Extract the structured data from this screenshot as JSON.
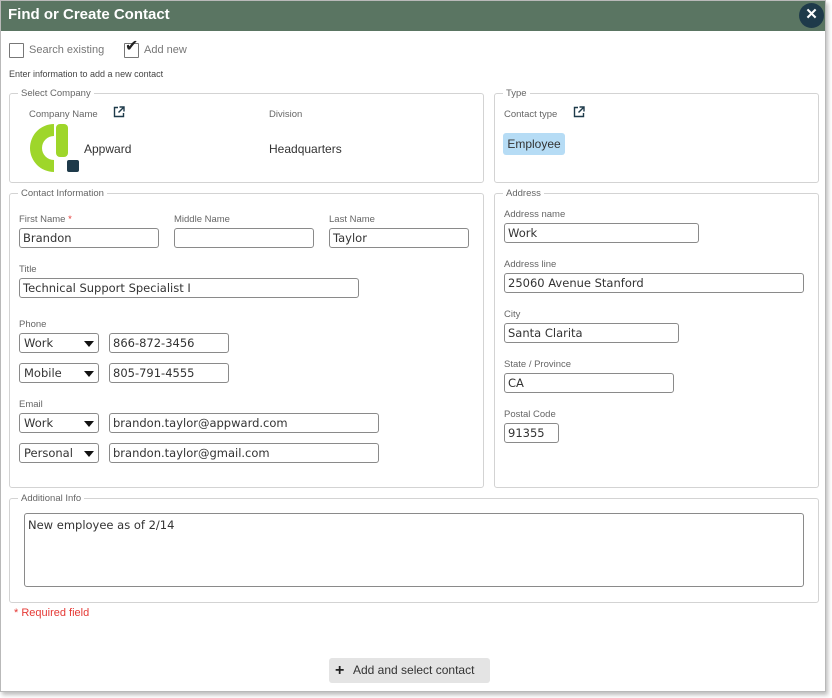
{
  "dialog": {
    "title": "Find or Create Contact",
    "close_icon": "close-icon"
  },
  "mode": {
    "search_existing": {
      "label": "Search existing",
      "checked": false
    },
    "add_new": {
      "label": "Add new",
      "checked": true
    },
    "instructions": "Enter information to add a new contact"
  },
  "select_company": {
    "legend": "Select Company",
    "company_name_label": "Company Name",
    "company_name": "Appward",
    "division_label": "Division",
    "division": "Headquarters",
    "logo_colors": {
      "ring": "#9ed62a",
      "square": "#1e3a4a"
    }
  },
  "type": {
    "legend": "Type",
    "contact_type_label": "Contact type",
    "contact_type": "Employee",
    "badge_color": "#b6dcf5"
  },
  "contact_info": {
    "legend": "Contact Information",
    "first_name_label": "First Name",
    "required_marker": "*",
    "first_name": "Brandon",
    "middle_name_label": "Middle Name",
    "middle_name": "",
    "last_name_label": "Last Name",
    "last_name": "Taylor",
    "title_label": "Title",
    "title": "Technical Support Specialist I",
    "phone_label": "Phone",
    "phones": [
      {
        "type": "Work",
        "number": "866-872-3456"
      },
      {
        "type": "Mobile",
        "number": "805-791-4555"
      }
    ],
    "email_label": "Email",
    "emails": [
      {
        "type": "Work",
        "address": "brandon.taylor@appward.com"
      },
      {
        "type": "Personal",
        "address": "brandon.taylor@gmail.com"
      }
    ]
  },
  "address": {
    "legend": "Address",
    "address_name_label": "Address name",
    "address_name": "Work",
    "address_line_label": "Address line",
    "address_line": "25060 Avenue Stanford",
    "city_label": "City",
    "city": "Santa Clarita",
    "state_label": "State / Province",
    "state": "CA",
    "postal_label": "Postal Code",
    "postal": "91355"
  },
  "additional": {
    "legend": "Additional Info",
    "text": "New employee as of 2/14"
  },
  "required_note": "* Required field",
  "footer": {
    "add_button": "Add and select contact",
    "plus_icon": "+"
  },
  "colors": {
    "titlebar": "#5a7562",
    "close_button": "#1e3a4a",
    "required": "#e53935"
  }
}
